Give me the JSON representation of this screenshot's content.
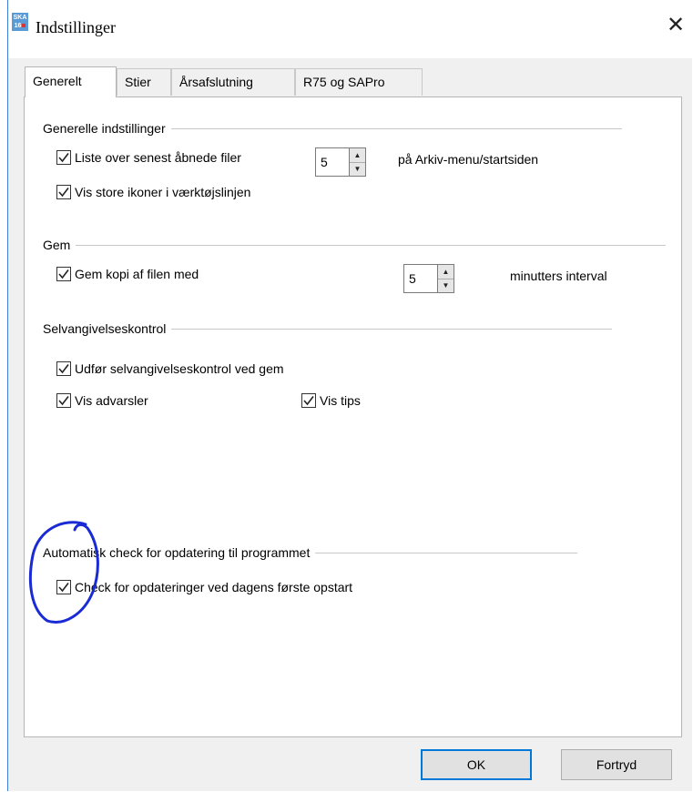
{
  "window": {
    "title": "Indstillinger",
    "icon_text_top": "SKA",
    "icon_text_bottom": "16"
  },
  "tabs": [
    {
      "label": "Generelt",
      "active": true
    },
    {
      "label": "Stier",
      "active": false
    },
    {
      "label": "Årsafslutning",
      "active": false
    },
    {
      "label": "R75 og SAPro",
      "active": false
    }
  ],
  "general": {
    "header": "Generelle indstillinger",
    "recent_files": {
      "label": "Liste over senest åbnede filer",
      "checked": true,
      "value": "5",
      "suffix": "på Arkiv-menu/startsiden"
    },
    "large_icons": {
      "label": "Vis store ikoner i værktøjslinjen",
      "checked": true
    }
  },
  "save": {
    "header": "Gem",
    "save_copy": {
      "label": "Gem kopi af filen  med",
      "checked": true,
      "value": "5",
      "suffix": "minutters interval"
    }
  },
  "tax_check": {
    "header": "Selvangivelseskontrol",
    "run_on_save": {
      "label": "Udfør selvangivelseskontrol ved gem",
      "checked": true
    },
    "show_warnings": {
      "label": "Vis advarsler",
      "checked": true
    },
    "show_tips": {
      "label": "Vis tips",
      "checked": true
    }
  },
  "update": {
    "header": "Automatisk check for opdatering til programmet",
    "check_on_start": {
      "label": "Check for opdateringer ved dagens første opstart",
      "checked": true
    }
  },
  "buttons": {
    "ok": "OK",
    "cancel": "Fortryd"
  },
  "colors": {
    "accent": "#0078d7",
    "annotation": "#1a2bd6"
  }
}
